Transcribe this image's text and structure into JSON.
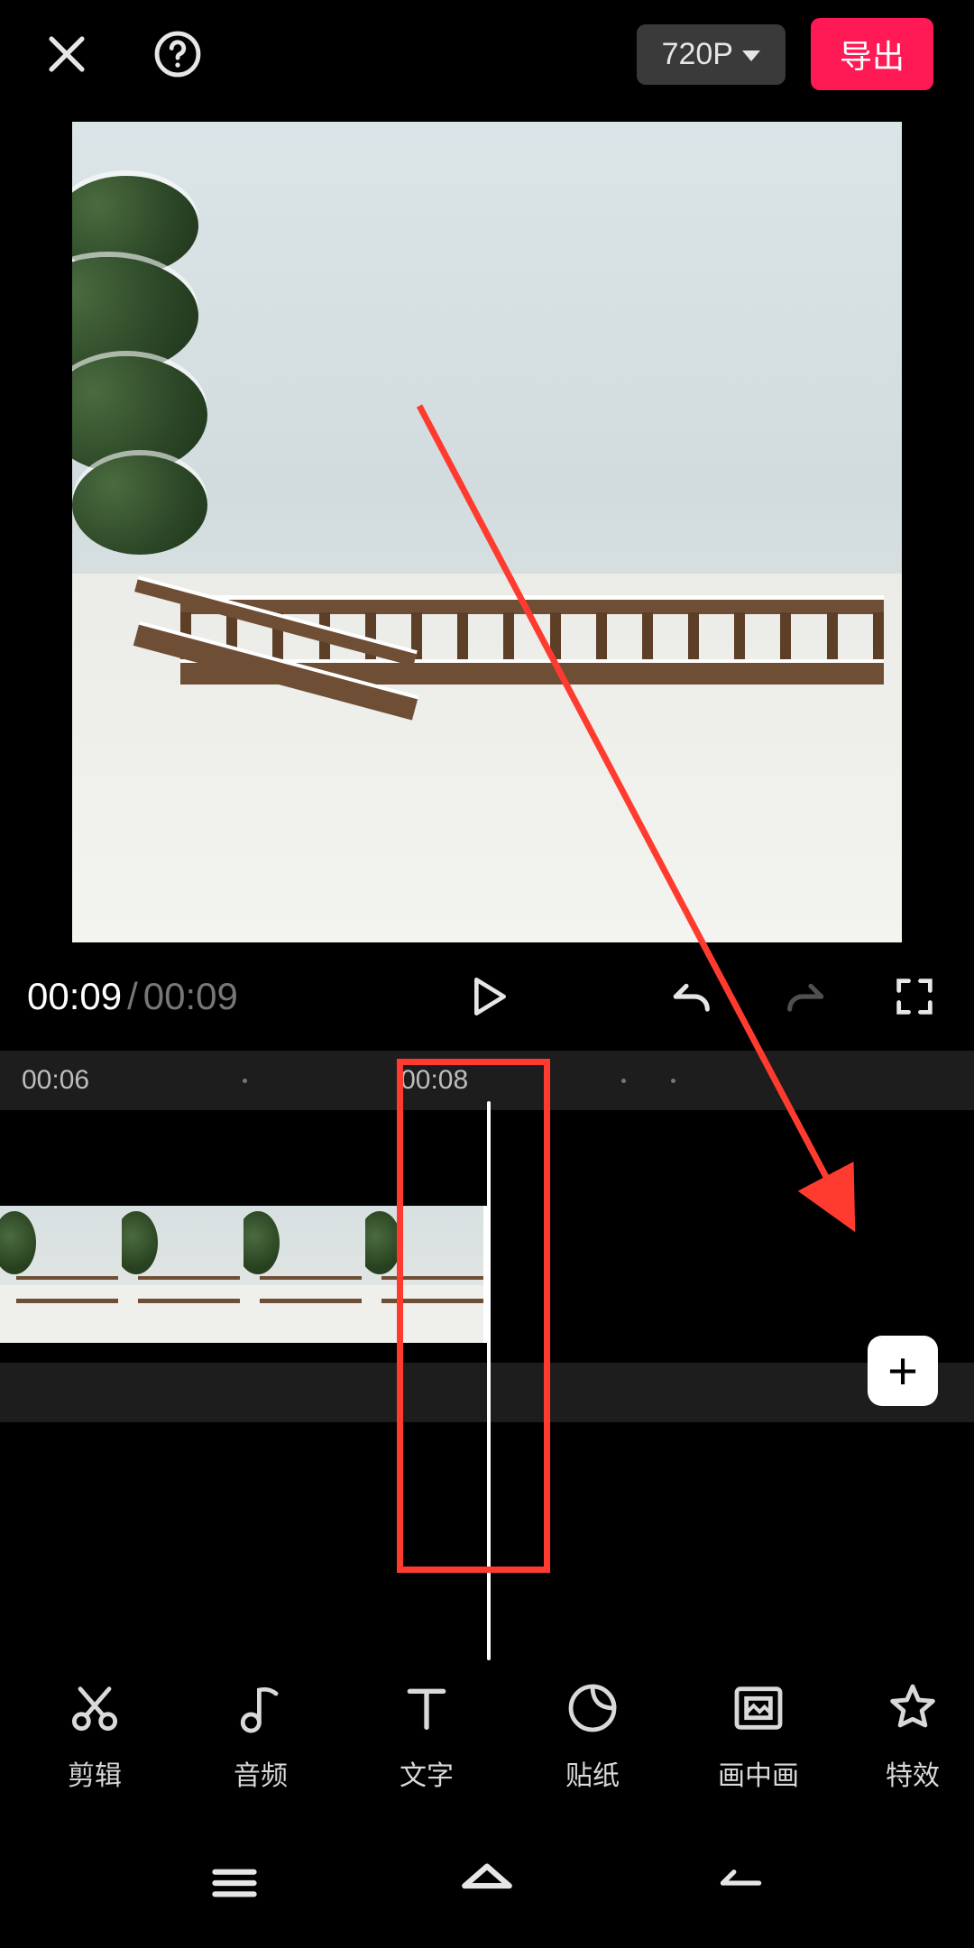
{
  "topbar": {
    "resolution_label": "720P",
    "export_label": "导出"
  },
  "playback": {
    "current_time": "00:09",
    "separator": "/",
    "duration": "00:09"
  },
  "timeline": {
    "ruler_labels": [
      "00:06",
      "00:08"
    ],
    "add_label": "+"
  },
  "tools": [
    {
      "id": "cut",
      "label": "剪辑"
    },
    {
      "id": "audio",
      "label": "音频"
    },
    {
      "id": "text",
      "label": "文字"
    },
    {
      "id": "sticker",
      "label": "贴纸"
    },
    {
      "id": "pip",
      "label": "画中画"
    },
    {
      "id": "effects",
      "label": "特效"
    }
  ],
  "annotation": {
    "arrow_color": "#ff3b30",
    "rect_color": "#ff3b30"
  }
}
